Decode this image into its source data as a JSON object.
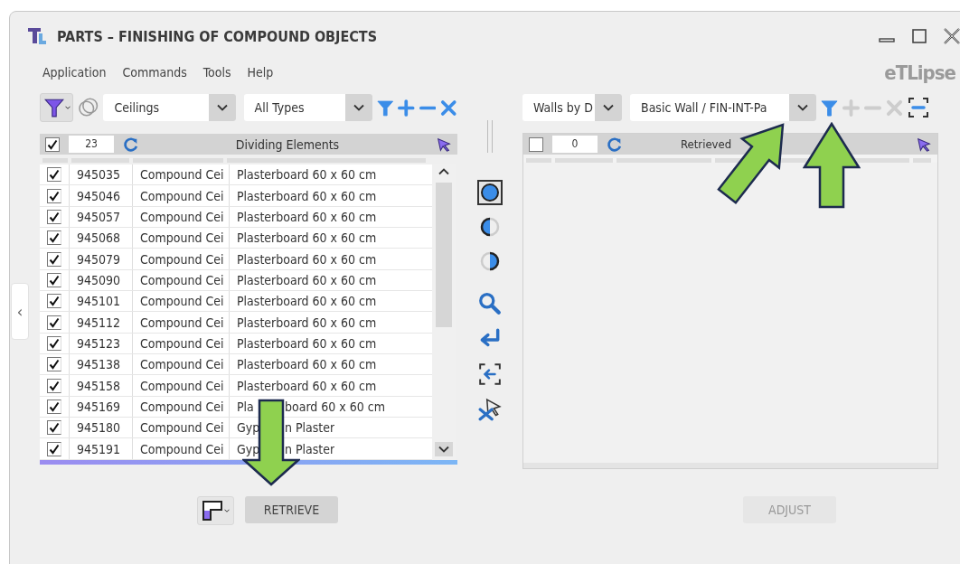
{
  "window": {
    "title": "PARTS – FINISHING OF COMPOUND OBJECTS"
  },
  "menu": [
    "Application",
    "Commands",
    "Tools",
    "Help"
  ],
  "logo": "eTLipse",
  "side_toggle": "‹",
  "left_toolbar": {
    "category": "Ceilings",
    "type": "All Types"
  },
  "left_list": {
    "checked": true,
    "count": "23",
    "title": "Dividing Elements",
    "rows": [
      {
        "checked": true,
        "id": "945035",
        "object": "Compound Cei",
        "type_parts": [
          "Plasterboard 60 x 60 cm"
        ]
      },
      {
        "checked": true,
        "id": "945046",
        "object": "Compound Cei",
        "type_parts": [
          "Plasterboard 60 x 60 cm"
        ]
      },
      {
        "checked": true,
        "id": "945057",
        "object": "Compound Cei",
        "type_parts": [
          "Plasterboard 60 x 60 cm"
        ]
      },
      {
        "checked": true,
        "id": "945068",
        "object": "Compound Cei",
        "type_parts": [
          "Plasterboard 60 x 60 cm"
        ]
      },
      {
        "checked": true,
        "id": "945079",
        "object": "Compound Cei",
        "type_parts": [
          "Plasterboard 60 x 60 cm"
        ]
      },
      {
        "checked": true,
        "id": "945090",
        "object": "Compound Cei",
        "type_parts": [
          "Plasterboard 60 x 60 cm"
        ]
      },
      {
        "checked": true,
        "id": "945101",
        "object": "Compound Cei",
        "type_parts": [
          "Plasterboard 60 x 60 cm"
        ]
      },
      {
        "checked": true,
        "id": "945112",
        "object": "Compound Cei",
        "type_parts": [
          "Plasterboard 60 x 60 cm"
        ]
      },
      {
        "checked": true,
        "id": "945123",
        "object": "Compound Cei",
        "type_parts": [
          "Plasterboard 60 x 60 cm"
        ]
      },
      {
        "checked": true,
        "id": "945138",
        "object": "Compound Cei",
        "type_parts": [
          "Plasterboard 60 x 60 cm"
        ]
      },
      {
        "checked": true,
        "id": "945158",
        "object": "Compound Cei",
        "type_parts": [
          "Plasterboard 60 x 60 cm"
        ]
      },
      {
        "checked": true,
        "id": "945169",
        "object": "Compound Cei",
        "type_parts": [
          "Pla",
          "board 60 x 60 cm"
        ]
      },
      {
        "checked": true,
        "id": "945180",
        "object": "Compound Cei",
        "type_parts": [
          "Gyp",
          "n Plaster"
        ]
      },
      {
        "checked": true,
        "id": "945191",
        "object": "Compound Cei",
        "type_parts": [
          "Gyp",
          "n Plaster"
        ]
      }
    ]
  },
  "modes": [
    {
      "kind": "full",
      "selected": true
    },
    {
      "kind": "left",
      "selected": false
    },
    {
      "kind": "right",
      "selected": false
    }
  ],
  "right_toolbar": {
    "category": "Walls by D",
    "type": "Basic Wall / FIN-INT-Pa",
    "edit_disabled": true
  },
  "right_list": {
    "checked": false,
    "count": "0",
    "title": "Retrieved"
  },
  "retrieve_button": {
    "label": "RETRIEVE",
    "disabled": false
  },
  "adjust_button": {
    "label": "ADJUST",
    "disabled": true
  }
}
